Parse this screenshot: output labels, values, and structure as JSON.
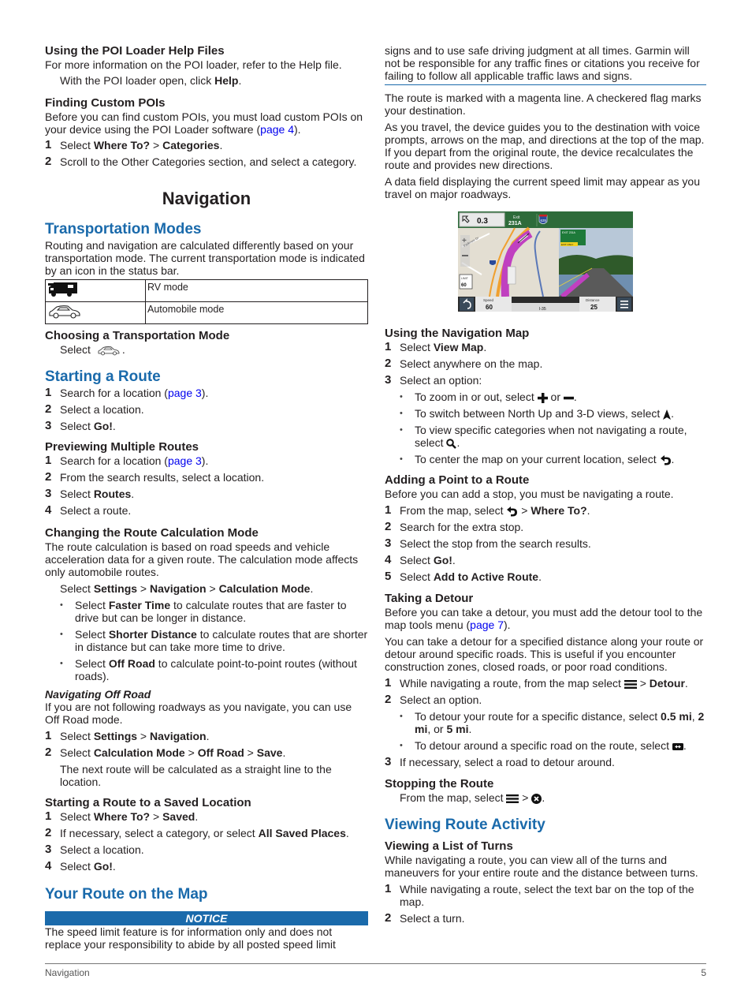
{
  "left": {
    "poi_help": {
      "heading": "Using the POI Loader Help Files",
      "text": "For more information on the POI loader, refer to the Help file.",
      "step_pre": "With the POI loader open, click ",
      "step_bold": "Help",
      "step_post": "."
    },
    "custom_pois": {
      "heading": "Finding Custom POIs",
      "text_pre": "Before you can find custom POIs, you must load custom POIs on your device using the POI Loader software (",
      "link": "page 4",
      "text_post": ").",
      "steps": [
        {
          "num": "1",
          "pre": "Select ",
          "b1": "Where To?",
          "mid": " > ",
          "b2": "Categories",
          "post": "."
        },
        {
          "num": "2",
          "text": "Scroll to the Other Categories section, and select a category."
        }
      ]
    },
    "chapter_title": "Navigation",
    "transport": {
      "heading": "Transportation Modes",
      "text": "Routing and navigation are calculated differently based on your transportation mode. The current transportation mode is indicated by an icon in the status bar.",
      "rows": [
        {
          "icon": "rv-icon",
          "label": "RV mode"
        },
        {
          "icon": "car-icon",
          "label": "Automobile mode"
        }
      ],
      "choose_heading": "Choosing a Transportation Mode",
      "choose_text": "Select",
      "choose_post": "."
    },
    "starting": {
      "heading": "Starting a Route",
      "steps": [
        {
          "num": "1",
          "pre": "Search for a location (",
          "link": "page 3",
          "post": ")."
        },
        {
          "num": "2",
          "text": "Select a location."
        },
        {
          "num": "3",
          "pre": "Select ",
          "bold": "Go!",
          "post": "."
        }
      ]
    },
    "previewing": {
      "heading": "Previewing Multiple Routes",
      "steps": [
        {
          "num": "1",
          "pre": "Search for a location (",
          "link": "page 3",
          "post": ")."
        },
        {
          "num": "2",
          "text": "From the search results, select a location."
        },
        {
          "num": "3",
          "pre": "Select ",
          "bold": "Routes",
          "post": "."
        },
        {
          "num": "4",
          "text": "Select a route."
        }
      ]
    },
    "calc_mode": {
      "heading": "Changing the Route Calculation Mode",
      "text": "The route calculation is based on road speeds and vehicle acceleration data for a given route. The calculation mode affects only automobile routes.",
      "select_pre": "Select ",
      "select_b1": "Settings",
      "select_b2": "Navigation",
      "select_b3": "Calculation Mode",
      "sep": " > ",
      "bullets": [
        {
          "pre": "Select ",
          "bold": "Faster Time",
          "post": " to calculate routes that are faster to drive but can be longer in distance."
        },
        {
          "pre": "Select ",
          "bold": "Shorter Distance",
          "post": " to calculate routes that are shorter in distance but can take more time to drive."
        },
        {
          "pre": "Select ",
          "bold": "Off Road",
          "post": " to calculate point-to-point routes (without roads)."
        }
      ]
    },
    "off_road": {
      "heading": "Navigating Off Road",
      "text": "If you are not following roadways as you navigate, you can use Off Road mode.",
      "step1": {
        "num": "1",
        "pre": "Select ",
        "b1": "Settings",
        "mid": " > ",
        "b2": "Navigation",
        "post": "."
      },
      "step2": {
        "num": "2",
        "pre": "Select ",
        "b1": "Calculation Mode",
        "b2": "Off Road",
        "b3": "Save",
        "sep": " > ",
        "post": "."
      },
      "note": "The next route will be calculated as a straight line to the location."
    },
    "saved": {
      "heading": "Starting a Route to a Saved Location",
      "steps": [
        {
          "num": "1",
          "pre": "Select ",
          "b1": "Where To?",
          "mid": " > ",
          "b2": "Saved",
          "post": "."
        },
        {
          "num": "2",
          "pre": "If necessary, select a category, or select ",
          "bold": "All Saved Places",
          "post": "."
        },
        {
          "num": "3",
          "text": "Select a location."
        },
        {
          "num": "4",
          "pre": "Select ",
          "bold": "Go!",
          "post": "."
        }
      ]
    },
    "your_route": {
      "heading": "Your Route on the Map",
      "notice": "NOTICE",
      "notice_text": "The speed limit feature is for information only and does not replace your responsibility to abide by all posted speed limit"
    }
  },
  "right": {
    "notice_cont": "signs and to use safe driving judgment at all times. Garmin will not be responsible for any traffic fines or citations you receive for failing to follow all applicable traffic laws and signs.",
    "para1": "The route is marked with a magenta line. A checkered flag marks your destination.",
    "para2": "As you travel, the device guides you to the destination with voice prompts, arrows on the map, and directions at the top of the map. If you depart from the original route, the device recalculates the route and provides new directions.",
    "para3": "A data field displaying the current speed limit may appear as you travel on major roadways.",
    "map": {
      "turn_distance": "0.3",
      "turn_unit": "mi",
      "exit_label": "Exit",
      "exit_number": "231A",
      "shield": "635",
      "road_shield": "35",
      "limit_label": "LIMIT",
      "limit_value": "60",
      "sign_exit": "EXIT 231A",
      "sign_only": "EXIT ONLY",
      "speed_label": "Speed",
      "speed_value": "60",
      "speed_unit": "mh",
      "road_name": "I-35",
      "distance_label": "Distance",
      "distance_value": "25",
      "distance_unit": "mi",
      "street": "Parkview Dr"
    },
    "nav_map": {
      "heading": "Using the Navigation Map",
      "steps": [
        {
          "num": "1",
          "pre": "Select ",
          "bold": "View Map",
          "post": "."
        },
        {
          "num": "2",
          "text": "Select anywhere on the map."
        },
        {
          "num": "3",
          "text": "Select an option:"
        }
      ],
      "bullets": {
        "zoom_pre": "To zoom in or out, select ",
        "zoom_mid": " or ",
        "zoom_post": ".",
        "view_pre": "To switch between North Up and 3-D views, select ",
        "view_post": ".",
        "cat_pre": "To view specific categories when not navigating a route, select ",
        "cat_post": ".",
        "center_pre": "To center the map on your current location, select ",
        "center_post": "."
      }
    },
    "add_point": {
      "heading": "Adding a Point to a Route",
      "text": "Before you can add a stop, you must be navigating a route.",
      "step1_pre": "From the map, select ",
      "step1_mid": " > ",
      "step1_bold": "Where To?",
      "step1_post": ".",
      "steps": [
        {
          "num": "2",
          "text": "Search for the extra stop."
        },
        {
          "num": "3",
          "text": "Select the stop from the search results."
        },
        {
          "num": "4",
          "pre": "Select ",
          "bold": "Go!",
          "post": "."
        },
        {
          "num": "5",
          "pre": "Select ",
          "bold": "Add to Active Route",
          "post": "."
        }
      ]
    },
    "detour": {
      "heading": "Taking a Detour",
      "text1_pre": "Before you can take a detour, you must add the detour tool to the map tools menu (",
      "text1_link": "page 7",
      "text1_post": ").",
      "text2": "You can take a detour for a specified distance along your route or detour around specific roads. This is useful if you encounter construction zones, closed roads, or poor road conditions.",
      "step1_pre": "While navigating a route, from the map select ",
      "step1_mid": " > ",
      "step1_bold": "Detour",
      "step1_post": ".",
      "step2": "Select an option.",
      "b1_pre": "To detour your route for a specific distance, select ",
      "b1_v1": "0.5 mi",
      "b1_v2": "2 mi",
      "b1_v3": "5 mi",
      "b1_sep": ", ",
      "b1_or": ", or ",
      "b1_post": ".",
      "b2_pre": "To detour around a specific road on the route, select ",
      "b2_post": ".",
      "step3": "If necessary, select a road to detour around."
    },
    "stopping": {
      "heading": "Stopping the Route",
      "pre": "From the map, select ",
      "mid": " > ",
      "post": "."
    },
    "activity": {
      "heading": "Viewing Route Activity",
      "sub": "Viewing a List of Turns",
      "text": "While navigating a route, you can view all of the turns and maneuvers for your entire route and the distance between turns.",
      "steps": [
        {
          "num": "1",
          "text": "While navigating a route, select the text bar on the top of the map."
        },
        {
          "num": "2",
          "text": "Select a turn."
        }
      ]
    }
  },
  "footer": {
    "section": "Navigation",
    "page": "5"
  }
}
